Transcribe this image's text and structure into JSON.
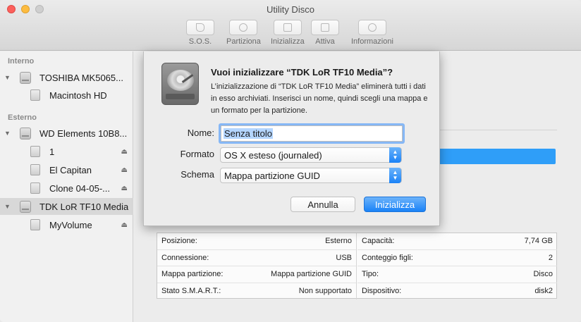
{
  "window": {
    "title": "Utility Disco"
  },
  "toolbar": {
    "items": [
      {
        "label": "S.O.S."
      },
      {
        "label": "Partiziona"
      },
      {
        "label": "Inizializza"
      },
      {
        "label": "Attiva"
      },
      {
        "label": "Informazioni"
      }
    ]
  },
  "sidebar": {
    "internal_header": "Interno",
    "external_header": "Esterno",
    "items": [
      {
        "label": "TOSHIBA MK5065..."
      },
      {
        "label": "Macintosh HD"
      },
      {
        "label": "WD Elements 10B8..."
      },
      {
        "label": "1"
      },
      {
        "label": "El Capitan"
      },
      {
        "label": "Clone 04-05-..."
      },
      {
        "label": "TDK LoR TF10 Media"
      },
      {
        "label": "MyVolume"
      }
    ]
  },
  "dialog": {
    "title": "Vuoi inizializzare “TDK LoR TF10 Media”?",
    "description": "L’inizializzazione di “TDK LoR TF10 Media” eliminerà tutti i dati in esso archiviati. Inserisci un nome, quindi scegli una mappa e un formato per la partizione.",
    "name_label": "Nome:",
    "name_value": "Senza titolo",
    "format_label": "Formato",
    "format_value": "OS X esteso (journaled)",
    "scheme_label": "Schema",
    "scheme_value": "Mappa partizione GUID",
    "cancel_label": "Annulla",
    "ok_label": "Inizializza"
  },
  "info": {
    "left": [
      {
        "key": "Posizione:",
        "value": "Esterno"
      },
      {
        "key": "Connessione:",
        "value": "USB"
      },
      {
        "key": "Mappa partizione:",
        "value": "Mappa partizione GUID"
      },
      {
        "key": "Stato S.M.A.R.T.:",
        "value": "Non supportato"
      }
    ],
    "right": [
      {
        "key": "Capacità:",
        "value": "7,74 GB"
      },
      {
        "key": "Conteggio figli:",
        "value": "2"
      },
      {
        "key": "Tipo:",
        "value": "Disco"
      },
      {
        "key": "Dispositivo:",
        "value": "disk2"
      }
    ]
  },
  "colors": {
    "accent": "#1a82f7",
    "selection": "#b4d5fe",
    "focus_ring": "#86b7f5"
  }
}
